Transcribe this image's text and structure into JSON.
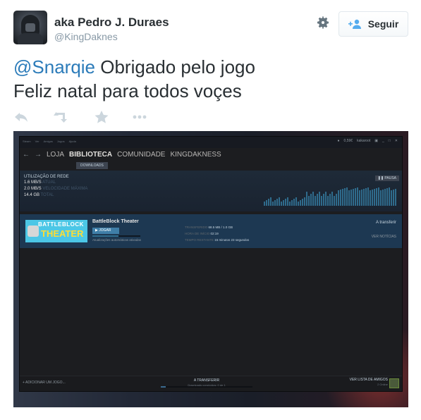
{
  "profile": {
    "display_name": "aka Pedro J. Duraes",
    "handle": "@KingDaknes"
  },
  "follow_button": {
    "label": "Seguir"
  },
  "tweet": {
    "mention": "@Snarqie",
    "line1": " Obrigado pelo jogo",
    "line2": "Feliz natal para todos voçes"
  },
  "actions": [
    "reply-icon",
    "retweet-icon",
    "favorite-icon",
    "more-icon"
  ],
  "steam": {
    "menu": [
      "Steam",
      "Ver",
      "Amigos",
      "Jogos",
      "Ajuda"
    ],
    "wallet": "0,59€",
    "user": "kakaroot",
    "nav": {
      "back": "←",
      "forward": "→",
      "items": [
        "LOJA",
        "BIBLIOTECA",
        "COMUNIDADE",
        "KINGDAKNESS"
      ],
      "active_index": 1
    },
    "subnav": "DOWNLOADS",
    "network": {
      "title": "UTILIZAÇÃO DE REDE",
      "current_value": "1.6 MB/S",
      "current_label": "ATUAL",
      "max_value": "2.0 MB/S",
      "max_label": "VELOCIDADE MÁXIMA",
      "total_value": "14.4 GB",
      "total_label": "TOTAL",
      "pause_label": "PAUSA"
    },
    "download": {
      "game_name": "BattleBlock Theater",
      "art_line1": "BATTLEBLOCK",
      "art_line2": "THEATER",
      "play_label": "JOGAR",
      "auto_updates": "Atualizações automáticas ativadas",
      "progress": 0.55,
      "transferred_label": "TRANSFERIDO",
      "transferred_value": "68.5 MB / 1.0 GB",
      "start_label": "HORA DE INÍCIO",
      "start_value": "02:19",
      "remaining_label": "TEMPO RESTANTE",
      "remaining_value": "15 minutos 23 segundos",
      "status": "A transferir",
      "news": "VER NOTÍCIAS"
    },
    "footer": {
      "add_game": "+ ADICIONAR UM JOGO...",
      "center_title": "A TRANSFERIR",
      "center_sub": "Downloads concluídos: 0 de 1",
      "progress": 0.05,
      "friends": "VER LISTA DE AMIGOS",
      "friends_online": "2 Online"
    }
  }
}
